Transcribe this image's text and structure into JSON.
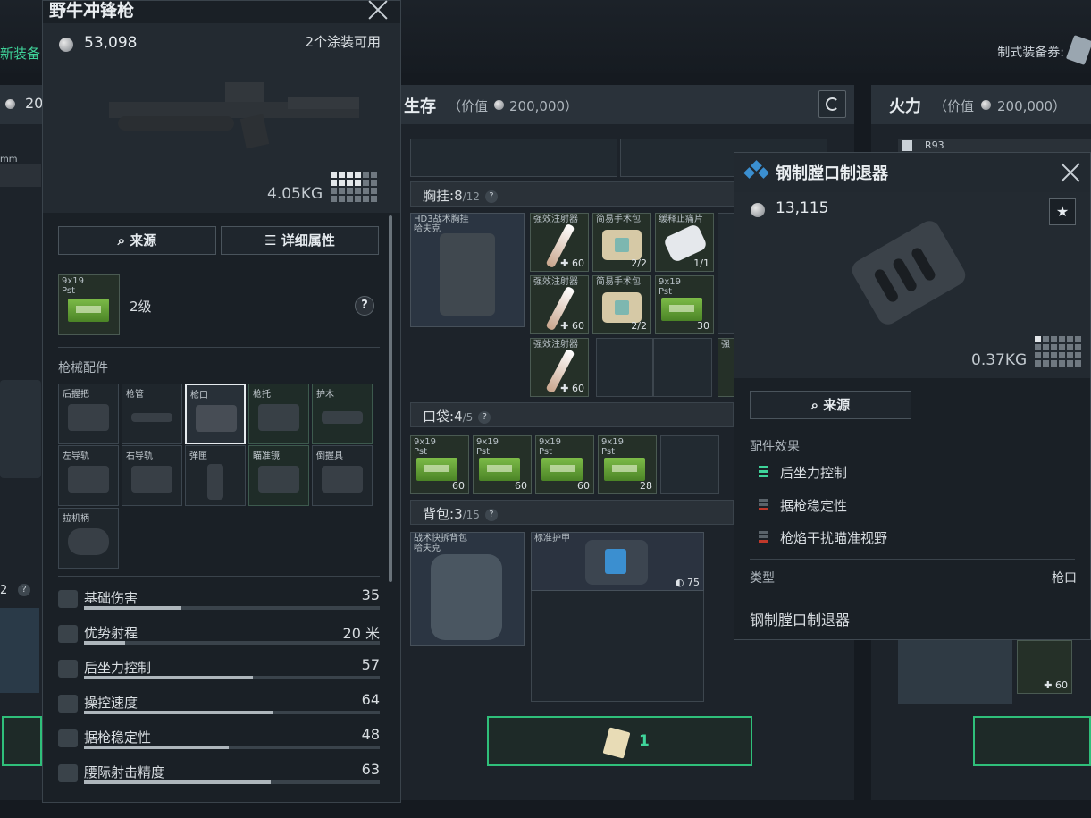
{
  "top": {
    "new_equipment": "新装备",
    "voucher_label": "制式装备券:"
  },
  "survival": {
    "title": "生存",
    "value_label": "（价值",
    "value_amount": "200,000）",
    "chest": {
      "label": "胸挂:",
      "count": "8",
      "max": "/12"
    },
    "pocket": {
      "label": "口袋:",
      "count": "4",
      "max": "/5"
    },
    "backpack": {
      "label": "背包:",
      "count": "3",
      "max": "/15"
    },
    "claim_count": "1"
  },
  "firepower": {
    "title": "火力",
    "value_label": "（价值",
    "value_amount": "200,000）",
    "weapon_label": "R93"
  },
  "left_partial": {
    "value": "20",
    "mm": "mm",
    "count2": "2"
  },
  "items": {
    "vest": {
      "label1": "HD3战术胸挂",
      "label2": "哈夫克"
    },
    "syringe1": {
      "label": "强效注射器",
      "count": "60"
    },
    "medkit1": {
      "label": "简易手术包",
      "count": "2/2"
    },
    "painkiller": {
      "label": "缓释止痛片",
      "count": "1/1"
    },
    "syringe2": {
      "label": "强效注射器",
      "count": "60"
    },
    "medkit2": {
      "label": "简易手术包",
      "count": "2/2"
    },
    "ammo_vest": {
      "label1": "9x19",
      "label2": "Pst",
      "count": "30"
    },
    "syringe3": {
      "label": "强效注射器",
      "count": "60"
    },
    "side_syringe": {
      "label": "强"
    },
    "pocket_ammo": [
      {
        "label1": "9x19",
        "label2": "Pst",
        "count": "60"
      },
      {
        "label1": "9x19",
        "label2": "Pst",
        "count": "60"
      },
      {
        "label1": "9x19",
        "label2": "Pst",
        "count": "60"
      },
      {
        "label1": "9x19",
        "label2": "Pst",
        "count": "28"
      }
    ],
    "backpack": {
      "label1": "战术快拆背包",
      "label2": "哈夫克"
    },
    "armor": {
      "label": "标准护甲",
      "durability": "75"
    },
    "fire_syringe": {
      "count": "60"
    }
  },
  "weapon_panel": {
    "title": "野牛冲锋枪",
    "price": "53,098",
    "skins": "2个涂装可用",
    "weight": "4.05KG",
    "source_btn": "来源",
    "detail_btn": "详细属性",
    "ammo": {
      "label1": "9x19",
      "label2": "Pst",
      "level": "2级"
    },
    "attach_title": "枪械配件",
    "attachments": [
      {
        "label": "后握把"
      },
      {
        "label": "枪管"
      },
      {
        "label": "枪口"
      },
      {
        "label": "枪托"
      },
      {
        "label": "护木"
      },
      {
        "label": "左导轨"
      },
      {
        "label": "右导轨"
      },
      {
        "label": "弹匣"
      },
      {
        "label": "瞄准镜"
      },
      {
        "label": "倒握具"
      },
      {
        "label": "拉机柄"
      }
    ],
    "stats": [
      {
        "name": "基础伤害",
        "value": "35",
        "fill": 0.33
      },
      {
        "name": "优势射程",
        "value": "20 米",
        "fill": 0.14
      },
      {
        "name": "后坐力控制",
        "value": "57",
        "fill": 0.57
      },
      {
        "name": "操控速度",
        "value": "64",
        "fill": 0.64
      },
      {
        "name": "据枪稳定性",
        "value": "48",
        "fill": 0.49
      },
      {
        "name": "腰际射击精度",
        "value": "63",
        "fill": 0.63
      }
    ]
  },
  "muzzle_popup": {
    "title": "钢制膛口制退器",
    "price": "13,115",
    "weight": "0.37KG",
    "source_btn": "来源",
    "effects_title": "配件效果",
    "effects": [
      {
        "name": "后坐力控制",
        "positive": true
      },
      {
        "name": "据枪稳定性",
        "positive": false
      },
      {
        "name": "枪焰干扰瞄准视野",
        "positive": false
      }
    ],
    "type_label": "类型",
    "type_value": "枪口",
    "footer_name": "钢制膛口制退器"
  },
  "colors": {
    "accent_green": "#2fbf7a",
    "positive": "#3fd49a",
    "negative": "#c0392b"
  }
}
